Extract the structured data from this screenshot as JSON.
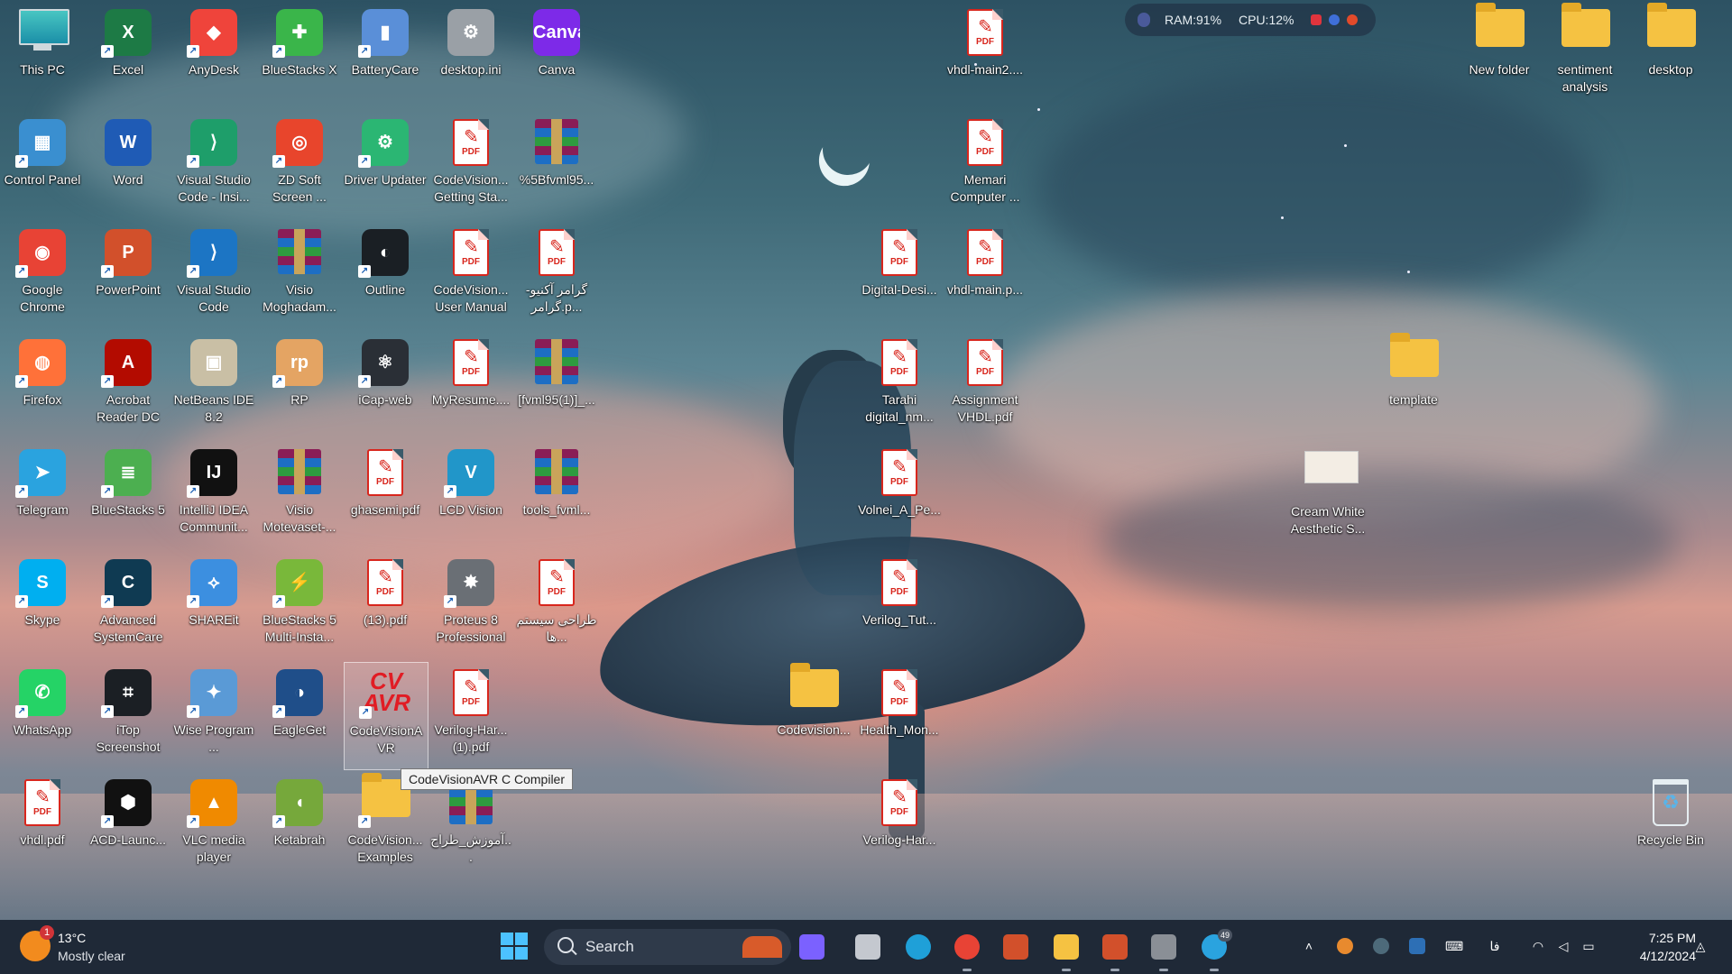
{
  "desktop": {
    "icons": [
      {
        "label": "This PC",
        "kind": "pc",
        "color": "#2aa6b5"
      },
      {
        "label": "Excel",
        "kind": "app",
        "color": "#1d7a45",
        "glyph": "X"
      },
      {
        "label": "AnyDesk",
        "kind": "app",
        "color": "#ef443b",
        "glyph": "◆"
      },
      {
        "label": "BlueStacks X",
        "kind": "app",
        "color": "#3ab54a",
        "glyph": "✚"
      },
      {
        "label": "BatteryCare",
        "kind": "app",
        "color": "#5a8fd8",
        "glyph": "▮"
      },
      {
        "label": "desktop.ini",
        "kind": "file",
        "color": "#9aa0a6",
        "glyph": "⚙"
      },
      {
        "label": "Canva",
        "kind": "app",
        "color": "#7d2ae8",
        "glyph": "Canva"
      },
      {
        "label": "vhdl-main2....",
        "kind": "pdf"
      },
      {
        "label": "RAM:91%",
        "kind": "skip"
      },
      {
        "label": "New folder",
        "kind": "folder"
      },
      {
        "label": "sentiment analysis",
        "kind": "folder"
      },
      {
        "label": "desktop",
        "kind": "folder"
      },
      {
        "label": "Control Panel",
        "kind": "app",
        "color": "#3a8fd0",
        "glyph": "▦"
      },
      {
        "label": "Word",
        "kind": "app",
        "color": "#1f5bb5",
        "glyph": "W"
      },
      {
        "label": "Visual Studio Code - Insi...",
        "kind": "app",
        "color": "#1e9e6a",
        "glyph": "⟩"
      },
      {
        "label": "ZD Soft Screen ...",
        "kind": "app",
        "color": "#e8452c",
        "glyph": "◎"
      },
      {
        "label": "Driver Updater",
        "kind": "app",
        "color": "#2bb673",
        "glyph": "⚙"
      },
      {
        "label": "CodeVision... Getting Sta...",
        "kind": "pdf"
      },
      {
        "label": "%5Bfvml95...",
        "kind": "rar"
      },
      {
        "label": "Memari Computer ...",
        "kind": "pdf"
      },
      {
        "label": "Google Chrome",
        "kind": "app",
        "color": "#e84335",
        "glyph": "◉"
      },
      {
        "label": "PowerPoint",
        "kind": "app",
        "color": "#d2502b",
        "glyph": "P"
      },
      {
        "label": "Visual Studio Code",
        "kind": "app",
        "color": "#1c75c4",
        "glyph": "⟩"
      },
      {
        "label": "Visio Moghadam...",
        "kind": "rar"
      },
      {
        "label": "Outline",
        "kind": "app",
        "color": "#1a1f24",
        "glyph": "◐"
      },
      {
        "label": "CodeVision... User Manual",
        "kind": "pdf"
      },
      {
        "label": "گرامر آکنیو-گرامر.p...",
        "kind": "pdf"
      },
      {
        "label": "Digital-Desi...",
        "kind": "pdf"
      },
      {
        "label": "vhdl-main.p...",
        "kind": "pdf"
      },
      {
        "label": "Firefox",
        "kind": "app",
        "color": "#ff7139",
        "glyph": "◍"
      },
      {
        "label": "Acrobat Reader DC",
        "kind": "app",
        "color": "#b30b00",
        "glyph": "A"
      },
      {
        "label": "NetBeans IDE 8.2",
        "kind": "app",
        "color": "#c9bfa5",
        "glyph": "▣"
      },
      {
        "label": "RP",
        "kind": "app",
        "color": "#e4a463",
        "glyph": "rp"
      },
      {
        "label": "iCap-web",
        "kind": "app",
        "color": "#2a2f36",
        "glyph": "⚛"
      },
      {
        "label": "MyResume....",
        "kind": "pdf"
      },
      {
        "label": "[fvml95(1)]_...",
        "kind": "rar"
      },
      {
        "label": "Tarahi digital_nm...",
        "kind": "pdf"
      },
      {
        "label": "Assignment VHDL.pdf",
        "kind": "pdf"
      },
      {
        "label": "template",
        "kind": "folder"
      },
      {
        "label": "Telegram",
        "kind": "app",
        "color": "#2aa3df",
        "glyph": "➤"
      },
      {
        "label": "BlueStacks 5",
        "kind": "app",
        "color": "#4caf50",
        "glyph": "≣"
      },
      {
        "label": "IntelliJ IDEA Communit...",
        "kind": "app",
        "color": "#111",
        "glyph": "IJ"
      },
      {
        "label": "Visio Motevaset-...",
        "kind": "rar"
      },
      {
        "label": "ghasemi.pdf",
        "kind": "pdf"
      },
      {
        "label": "LCD Vision",
        "kind": "app",
        "color": "#2196c9",
        "glyph": "V"
      },
      {
        "label": "tools_fvml...",
        "kind": "rar"
      },
      {
        "label": "Volnei_A_Pe...",
        "kind": "pdf"
      },
      {
        "label": "Cream White Aesthetic S...",
        "kind": "thumb"
      },
      {
        "label": "Skype",
        "kind": "app",
        "color": "#00aff0",
        "glyph": "S"
      },
      {
        "label": "Advanced SystemCare",
        "kind": "app",
        "color": "#0f3a52",
        "glyph": "C"
      },
      {
        "label": "SHAREit",
        "kind": "app",
        "color": "#3c8fe0",
        "glyph": "⟡"
      },
      {
        "label": "BlueStacks 5 Multi-Insta...",
        "kind": "app",
        "color": "#79b83a",
        "glyph": "⚡"
      },
      {
        "label": "(13).pdf",
        "kind": "pdf"
      },
      {
        "label": "Proteus 8 Professional",
        "kind": "app",
        "color": "#6a6f75",
        "glyph": "✸"
      },
      {
        "label": "طراحی سیستم ها...",
        "kind": "pdf"
      },
      {
        "label": "Verilog_Tut...",
        "kind": "pdf"
      },
      {
        "label": "WhatsApp",
        "kind": "app",
        "color": "#25d366",
        "glyph": "✆"
      },
      {
        "label": "iTop Screenshot",
        "kind": "app",
        "color": "#1b1f24",
        "glyph": "⌗"
      },
      {
        "label": "Wise Program ...",
        "kind": "app",
        "color": "#5a9ad6",
        "glyph": "✦"
      },
      {
        "label": "EagleGet",
        "kind": "app",
        "color": "#1f4e89",
        "glyph": "◑"
      },
      {
        "label": "CodeVisionA VR",
        "kind": "cvavr"
      },
      {
        "label": "Verilog-Har... (1).pdf",
        "kind": "pdf"
      },
      {
        "label": "Codevision...",
        "kind": "folder"
      },
      {
        "label": "Health_Mon...",
        "kind": "pdf"
      },
      {
        "label": "vhdl.pdf",
        "kind": "pdf"
      },
      {
        "label": "ACD-Launc...",
        "kind": "app",
        "color": "#111",
        "glyph": "⬢"
      },
      {
        "label": "VLC media player",
        "kind": "app",
        "color": "#f08a00",
        "glyph": "▲"
      },
      {
        "label": "Ketabrah",
        "kind": "app",
        "color": "#76a83b",
        "glyph": "◖"
      },
      {
        "label": "CodeVision... Examples",
        "kind": "folder"
      },
      {
        "label": "آموزش_طراح...",
        "kind": "rar"
      },
      {
        "label": "Verilog-Har...",
        "kind": "pdf"
      },
      {
        "label": "Recycle Bin",
        "kind": "bin"
      }
    ],
    "tooltip": "CodeVisionAVR C Compiler",
    "pdf_text": "PDF"
  },
  "hwmon": {
    "ram": "RAM:91%",
    "cpu": "CPU:12%"
  },
  "taskbar": {
    "weather": {
      "badge": "1",
      "temp": "13°C",
      "condition": "Mostly clear"
    },
    "search_placeholder": "Search",
    "apps": [
      {
        "name": "copilot",
        "color": "#7b61ff"
      },
      {
        "name": "task-view",
        "color": "#c4c8cf"
      },
      {
        "name": "edge",
        "color": "#1fa0d8"
      },
      {
        "name": "chrome",
        "color": "#e84335"
      },
      {
        "name": "presenter",
        "color": "#d2502b"
      },
      {
        "name": "file-explorer",
        "color": "#f5c242"
      },
      {
        "name": "powerpoint",
        "color": "#d2502b"
      },
      {
        "name": "proteus",
        "color": "#8a8f96"
      },
      {
        "name": "telegram",
        "color": "#2aa3df"
      }
    ],
    "telegram_badge": "49",
    "lang": "فا",
    "time": "7:25 PM",
    "date": "4/12/2024"
  }
}
